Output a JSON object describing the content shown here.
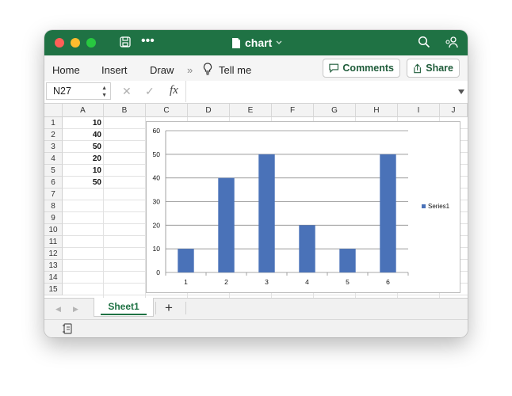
{
  "window": {
    "title": "chart"
  },
  "ribbon": {
    "tabs": [
      "Home",
      "Insert",
      "Draw"
    ],
    "more_symbol": "»",
    "tell_me": "Tell me",
    "comments_label": "Comments",
    "share_label": "Share"
  },
  "formula_bar": {
    "name_box": "N27",
    "cancel_symbol": "✕",
    "enter_symbol": "✓",
    "fx_symbol": "fx",
    "formula": ""
  },
  "grid": {
    "columns": [
      "A",
      "B",
      "C",
      "D",
      "E",
      "F",
      "G",
      "H",
      "I",
      "J"
    ],
    "rows": [
      "1",
      "2",
      "3",
      "4",
      "5",
      "6",
      "7",
      "8",
      "9",
      "10",
      "11",
      "12",
      "13",
      "14",
      "15"
    ],
    "column_a_values": [
      "10",
      "40",
      "50",
      "20",
      "10",
      "50"
    ]
  },
  "chart_data": {
    "type": "bar",
    "categories": [
      "1",
      "2",
      "3",
      "4",
      "5",
      "6"
    ],
    "series": [
      {
        "name": "Series1",
        "values": [
          10,
          40,
          50,
          20,
          10,
          50
        ],
        "color": "#4a72b8"
      }
    ],
    "ylim": [
      0,
      60
    ],
    "yticks": [
      "0",
      "10",
      "20",
      "30",
      "40",
      "50",
      "60"
    ],
    "grid": true,
    "legend": "right"
  },
  "sheet_tabs": {
    "active": "Sheet1",
    "add_label": "+",
    "prev_symbol": "◀",
    "next_symbol": "▶"
  },
  "colors": {
    "accent": "#1f7244",
    "bar": "#4a72b8"
  }
}
